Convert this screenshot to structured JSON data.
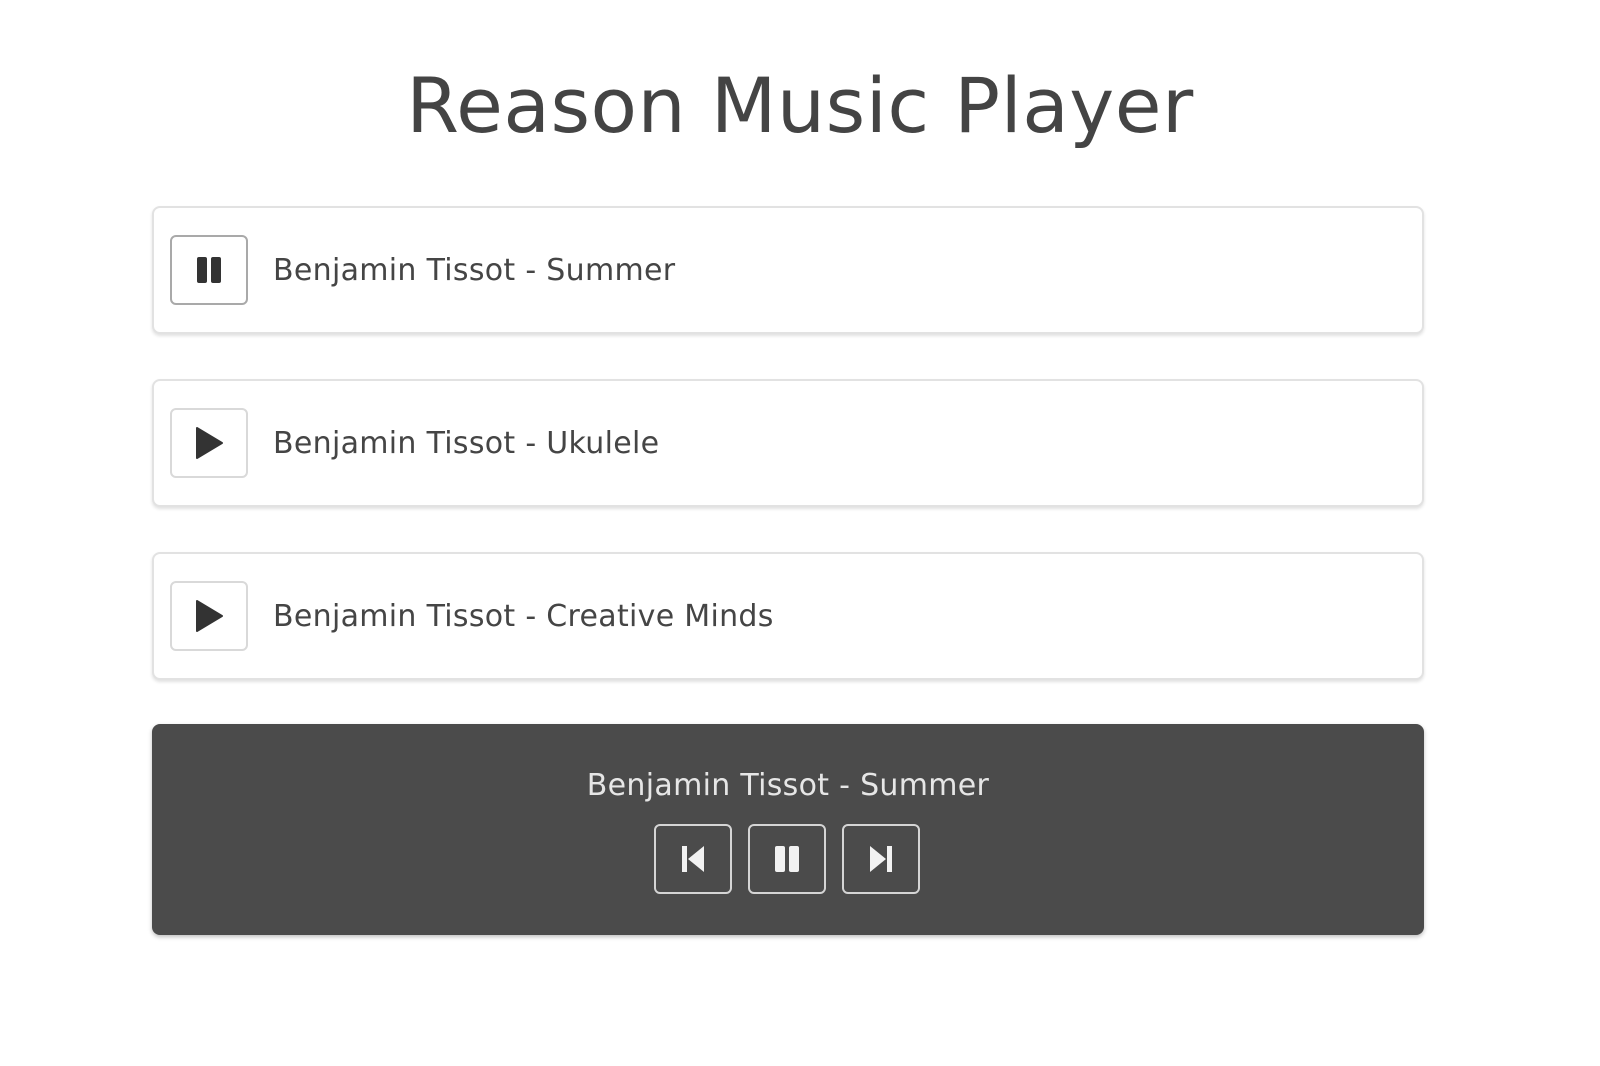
{
  "app": {
    "title": "Reason Music Player"
  },
  "playlist": {
    "tracks": [
      {
        "label": "Benjamin Tissot - Summer",
        "state": "playing",
        "button_icon": "pause-icon"
      },
      {
        "label": "Benjamin Tissot - Ukulele",
        "state": "stopped",
        "button_icon": "play-icon"
      },
      {
        "label": "Benjamin Tissot - Creative Minds",
        "state": "stopped",
        "button_icon": "play-icon"
      }
    ]
  },
  "player": {
    "now_playing": "Benjamin Tissot - Summer",
    "controls": [
      {
        "name": "previous",
        "icon": "skip-previous-icon"
      },
      {
        "name": "play-pause",
        "icon": "pause-icon"
      },
      {
        "name": "next",
        "icon": "skip-next-icon"
      }
    ]
  },
  "colors": {
    "background": "#ffffff",
    "text": "#454545",
    "player_bg": "#4b4b4b",
    "player_text": "#e6e6e6",
    "icon_dark": "#333333",
    "icon_light": "#f2f2f2"
  }
}
